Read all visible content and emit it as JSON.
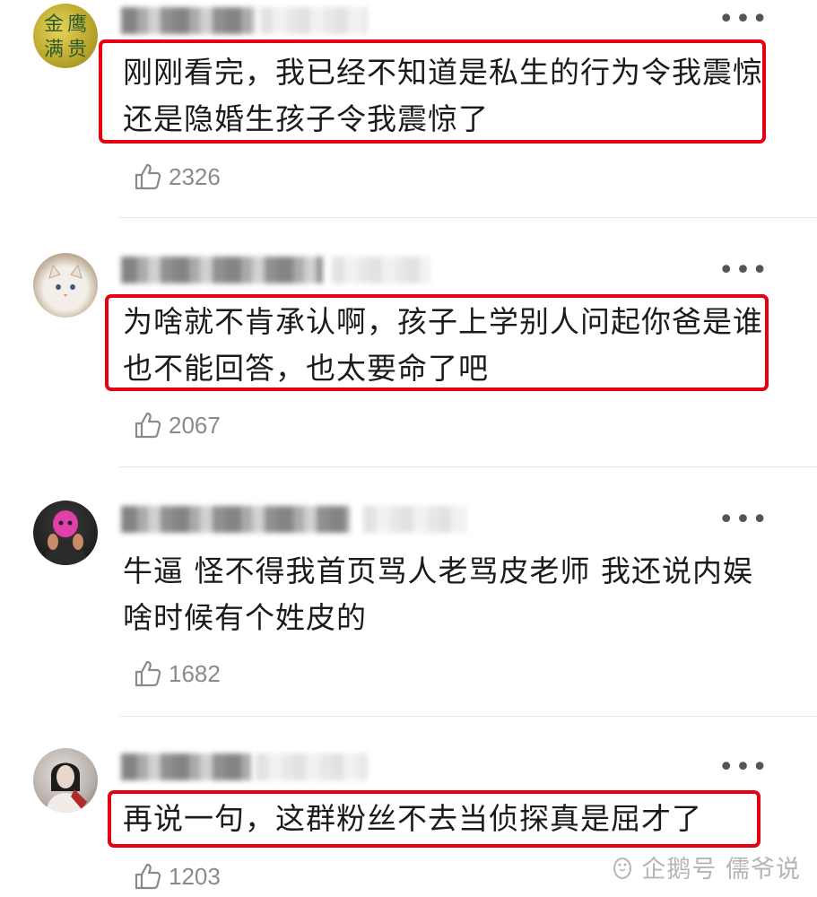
{
  "comments": [
    {
      "avatar": "golden-calligraphy-avatar",
      "text": "刚刚看完，我已经不知道是私生的行为令我震惊还是隐婚生孩子令我震惊了",
      "likes": "2326",
      "highlighted": true
    },
    {
      "avatar": "white-cat-avatar",
      "text": "为啥就不肯承认啊，孩子上学别人问起你爸是谁也不能回答，也太要命了吧",
      "likes": "2067",
      "highlighted": true
    },
    {
      "avatar": "pink-mask-person-avatar",
      "text": "牛逼 怪不得我首页骂人老骂皮老师 我还说内娱啥时候有个姓皮的",
      "likes": "1682",
      "highlighted": false
    },
    {
      "avatar": "woman-portrait-avatar",
      "text": "再说一句，这群粉丝不去当侦探真是屈才了",
      "likes": "1203",
      "highlighted": true
    }
  ],
  "icons": {
    "more": "more-options-icon",
    "like": "thumbs-up-icon"
  },
  "colors": {
    "highlight": "#e60012",
    "like_count": "#8a8a8a",
    "text": "#1b1b1b"
  },
  "watermark": {
    "text": "企鹅号 儒爷说"
  }
}
